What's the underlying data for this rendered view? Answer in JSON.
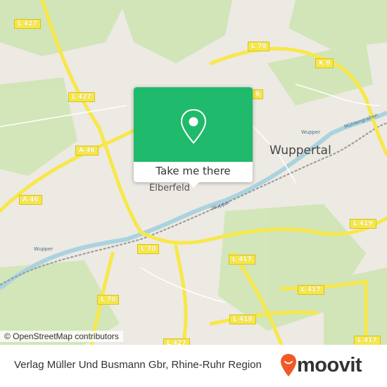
{
  "map": {
    "road_shields": [
      {
        "label": "L 427"
      },
      {
        "label": "L 70"
      },
      {
        "label": "K 8"
      },
      {
        "label": "L 427"
      },
      {
        "label": "6"
      },
      {
        "label": "A 46"
      },
      {
        "label": "A 46"
      },
      {
        "label": "L 70"
      },
      {
        "label": "L 417"
      },
      {
        "label": "L 419"
      },
      {
        "label": "L 417"
      },
      {
        "label": "L 70"
      },
      {
        "label": "L 418"
      },
      {
        "label": "L 427"
      },
      {
        "label": "L 417"
      }
    ],
    "places": {
      "city": "Wuppertal",
      "district": "Elberfeld"
    },
    "water_labels": [
      "Wupper",
      "Wupper",
      "Wupper",
      "Mühlengraben"
    ],
    "attribution": "© OpenStreetMap contributors",
    "colors": {
      "popup": "#1fba6b",
      "road": "#f7e84a",
      "water": "#aad3df",
      "green": "#cde6b0"
    }
  },
  "popup": {
    "icon": "map-pin-icon",
    "button_label": "Take me there"
  },
  "footer": {
    "place_name": "Verlag Müller Und Busmann Gbr, Rhine-Ruhr Region",
    "brand": "moovit",
    "brand_color": "#f05a28"
  }
}
